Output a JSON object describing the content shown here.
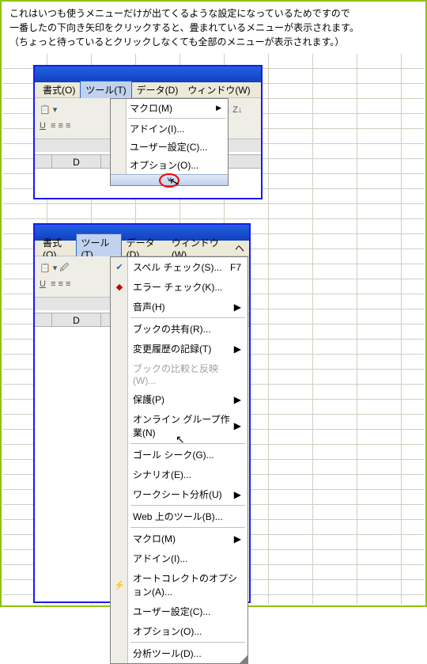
{
  "intro": {
    "line1": "これはいつも使うメニューだけが出てくるような設定になっているためですので",
    "line2": "一番したの下向き矢印をクリックすると、畳まれているメニューが表示されます。",
    "line3": "（ちょっと待っているとクリックしなくても全部のメニューが表示されます。）"
  },
  "menubar": {
    "format": "書式(O)",
    "tools": "ツール(T)",
    "data": "データ(D)",
    "window": "ウィンドウ(W)"
  },
  "menubar2_extra": "ヘ",
  "colhdr": {
    "d": "D"
  },
  "dd1": {
    "macro": "マクロ(M)",
    "addin": "アドイン(I)...",
    "userset": "ユーザー設定(C)...",
    "options": "オプション(O)..."
  },
  "dd2": {
    "spell": "スペル チェック(S)...",
    "spell_sc": "F7",
    "error": "エラー チェック(K)...",
    "speech": "音声(H)",
    "share": "ブックの共有(R)...",
    "track": "変更履歴の記録(T)",
    "compare": "ブックの比較と反映(W)...",
    "protect": "保護(P)",
    "online": "オンライン グループ作業(N)",
    "goal": "ゴール シーク(G)...",
    "scenario": "シナリオ(E)...",
    "wsanal": "ワークシート分析(U)",
    "webtool": "Web 上のツール(B)...",
    "macro": "マクロ(M)",
    "addin": "アドイン(I)...",
    "autocorr": "オートコレクトのオプション(A)...",
    "userset": "ユーザー設定(C)...",
    "options": "オプション(O)...",
    "analysis": "分析ツール(D)..."
  },
  "arrow": "▶",
  "chevdown": "˅"
}
